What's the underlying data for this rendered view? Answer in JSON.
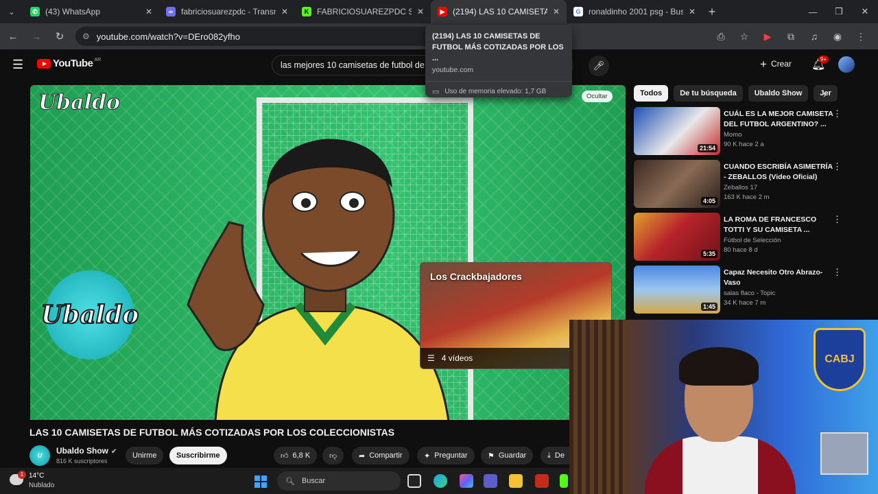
{
  "tabs": [
    {
      "title": "(43) WhatsApp",
      "favicon_color": "#25d366",
      "active": false
    },
    {
      "title": "fabriciosuarezpdc - Transmisión",
      "favicon_color": "#6e6ef0",
      "active": false
    },
    {
      "title": "FABRICIOSUAREZPDC Stream -",
      "favicon_color": "#53fc18",
      "active": false
    },
    {
      "title": "(2194) LAS 10 CAMISETAS DE F",
      "favicon_color": "#ff0000",
      "active": true
    },
    {
      "title": "ronaldinho 2001 psg - Buscar c",
      "favicon_color": "#4285f4",
      "active": false
    }
  ],
  "address": {
    "url": "youtube.com/watch?v=DEro082yfho"
  },
  "tooltip": {
    "title": "(2194) LAS 10 CAMISETAS DE FUTBOL MÁS COTIZADAS POR LOS ...",
    "domain": "youtube.com",
    "memory": "Uso de memoria elevado: 1,7 GB"
  },
  "youtube": {
    "logo": "YouTube",
    "country": "AR",
    "search_query": "las mejores 10 camisetas de futbol de la",
    "create_label": "Crear",
    "notif_count": "9+"
  },
  "video": {
    "watermark": "Ubaldo",
    "badge_text": "Ubaldo",
    "hide_label": "Ocultar",
    "title": "LAS 10 CAMISETAS DE FUTBOL MÁS COTIZADAS POR LOS COLECCIONISTAS",
    "playlist": {
      "title": "Los Crackbajadores",
      "count": "4 vídeos"
    }
  },
  "channel": {
    "name": "Ubaldo Show",
    "subs": "816 K suscriptores",
    "join": "Unirme",
    "subscribe": "Suscribirme"
  },
  "actions": {
    "likes": "6,8 K",
    "share": "Compartir",
    "ask": "Preguntar",
    "save": "Guardar",
    "download": "De"
  },
  "chips": [
    "Todos",
    "De tu búsqueda",
    "Ubaldo Show",
    "Jer"
  ],
  "recommendations": [
    {
      "title": "CUÁL ES LA MEJOR CAMISETA DEL FUTBOL ARGENTINO? ...",
      "channel": "Momo",
      "meta": "90 K hace 2 a",
      "duration": "21:54",
      "thumb": "#1e4fb5"
    },
    {
      "title": "CUANDO ESCRIBÍA ASIMETRÍA - ZEBALLOS (Video Oficial)",
      "channel": "Zeballos 17",
      "meta": "163 K hace 2 m",
      "duration": "4:05",
      "thumb": "#3b2a22"
    },
    {
      "title": "LA ROMA DE FRANCESCO TOTTI Y SU CAMISETA ...",
      "channel": "Fútbol de Selección",
      "meta": "80 hace 8 d",
      "duration": "5:35",
      "thumb": "#b8232a"
    },
    {
      "title": "Capaz Necesito Otro Abrazo- Vaso",
      "channel": "salas flaco - Topic",
      "meta": "34 K hace 7 m",
      "duration": "1:45",
      "thumb": "#4b88e0"
    }
  ],
  "webcam": {
    "shield_text": "CABJ"
  },
  "taskbar": {
    "temp": "14°C",
    "weather": "Nublado",
    "weather_badge": "1",
    "search_label": "Buscar"
  }
}
